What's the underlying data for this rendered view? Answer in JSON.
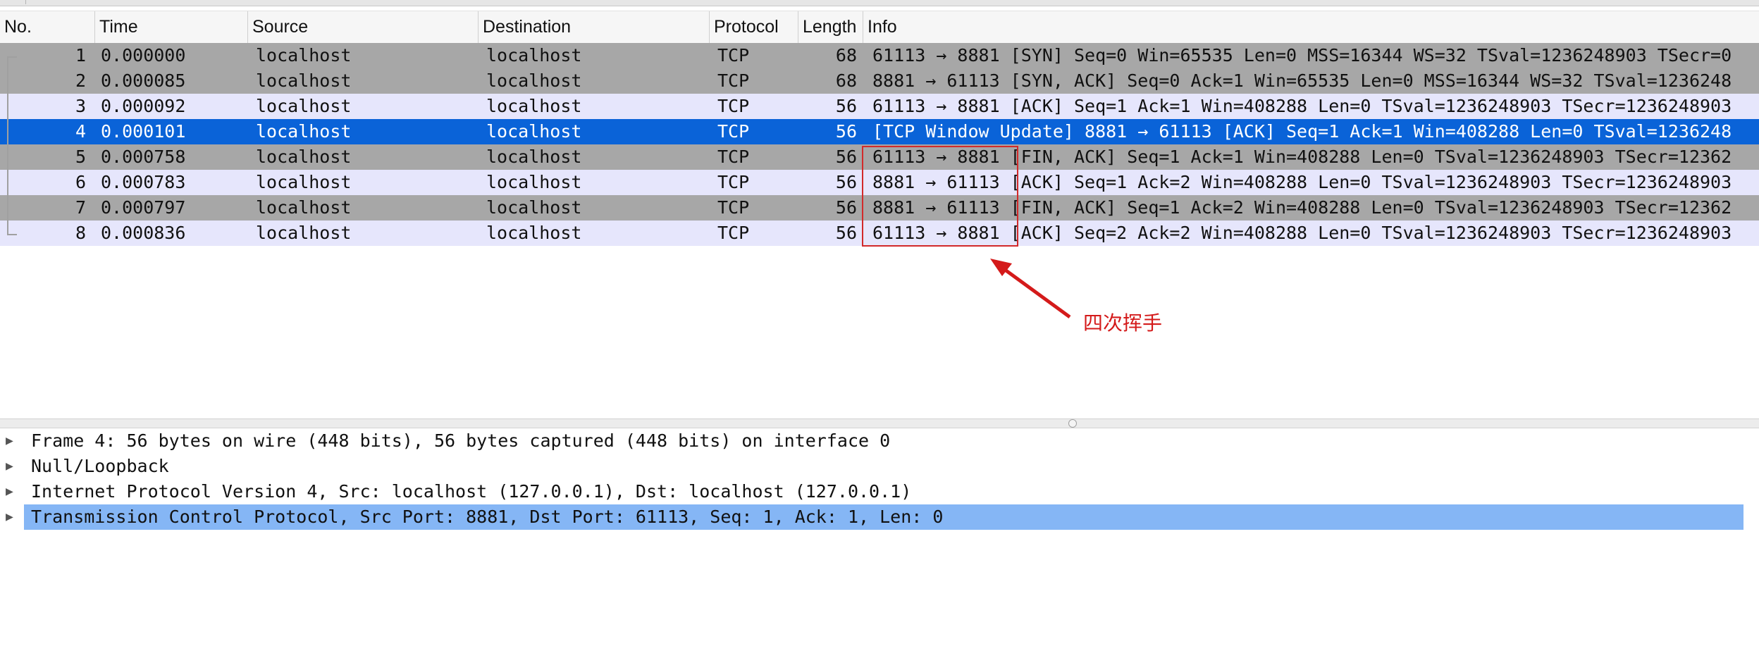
{
  "columns": [
    "No.",
    "Time",
    "Source",
    "Destination",
    "Protocol",
    "Length",
    "Info"
  ],
  "packets": [
    {
      "no": "1",
      "time": "0.000000",
      "src": "localhost",
      "dst": "localhost",
      "proto": "TCP",
      "len": "68",
      "info": "61113 → 8881 [SYN] Seq=0 Win=65535 Len=0 MSS=16344 WS=32 TSval=1236248903 TSecr=0"
    },
    {
      "no": "2",
      "time": "0.000085",
      "src": "localhost",
      "dst": "localhost",
      "proto": "TCP",
      "len": "68",
      "info": "8881 → 61113 [SYN, ACK] Seq=0 Ack=1 Win=65535 Len=0 MSS=16344 WS=32 TSval=1236248"
    },
    {
      "no": "3",
      "time": "0.000092",
      "src": "localhost",
      "dst": "localhost",
      "proto": "TCP",
      "len": "56",
      "info": "61113 → 8881 [ACK] Seq=1 Ack=1 Win=408288 Len=0 TSval=1236248903 TSecr=1236248903"
    },
    {
      "no": "4",
      "time": "0.000101",
      "src": "localhost",
      "dst": "localhost",
      "proto": "TCP",
      "len": "56",
      "info": "[TCP Window Update] 8881 → 61113 [ACK] Seq=1 Ack=1 Win=408288 Len=0 TSval=1236248"
    },
    {
      "no": "5",
      "time": "0.000758",
      "src": "localhost",
      "dst": "localhost",
      "proto": "TCP",
      "len": "56",
      "info": "61113 → 8881 [FIN, ACK] Seq=1 Ack=1 Win=408288 Len=0 TSval=1236248903 TSecr=12362"
    },
    {
      "no": "6",
      "time": "0.000783",
      "src": "localhost",
      "dst": "localhost",
      "proto": "TCP",
      "len": "56",
      "info": "8881 → 61113 [ACK] Seq=1 Ack=2 Win=408288 Len=0 TSval=1236248903 TSecr=1236248903"
    },
    {
      "no": "7",
      "time": "0.000797",
      "src": "localhost",
      "dst": "localhost",
      "proto": "TCP",
      "len": "56",
      "info": "8881 → 61113 [FIN, ACK] Seq=1 Ack=2 Win=408288 Len=0 TSval=1236248903 TSecr=12362"
    },
    {
      "no": "8",
      "time": "0.000836",
      "src": "localhost",
      "dst": "localhost",
      "proto": "TCP",
      "len": "56",
      "info": "61113 → 8881 [ACK] Seq=2 Ack=2 Win=408288 Len=0 TSval=1236248903 TSecr=1236248903"
    }
  ],
  "row_styles": [
    "gray",
    "gray",
    "lav",
    "sel",
    "gray",
    "lav",
    "gray",
    "lav"
  ],
  "annotation": {
    "label": "四次挥手",
    "color": "#d41a1a"
  },
  "details": [
    {
      "text": "Frame 4: 56 bytes on wire (448 bits), 56 bytes captured (448 bits) on interface 0",
      "highlighted": false
    },
    {
      "text": "Null/Loopback",
      "highlighted": false
    },
    {
      "text": "Internet Protocol Version 4, Src: localhost (127.0.0.1), Dst: localhost (127.0.0.1)",
      "highlighted": false
    },
    {
      "text": "Transmission Control Protocol, Src Port: 8881, Dst Port: 61113, Seq: 1, Ack: 1, Len: 0",
      "highlighted": true
    }
  ],
  "colors": {
    "selected_row": "#0a63d8",
    "gray_row": "#a7a7a7",
    "lavender_row": "#e6e6fc",
    "detail_highlight": "#85b6f5"
  }
}
